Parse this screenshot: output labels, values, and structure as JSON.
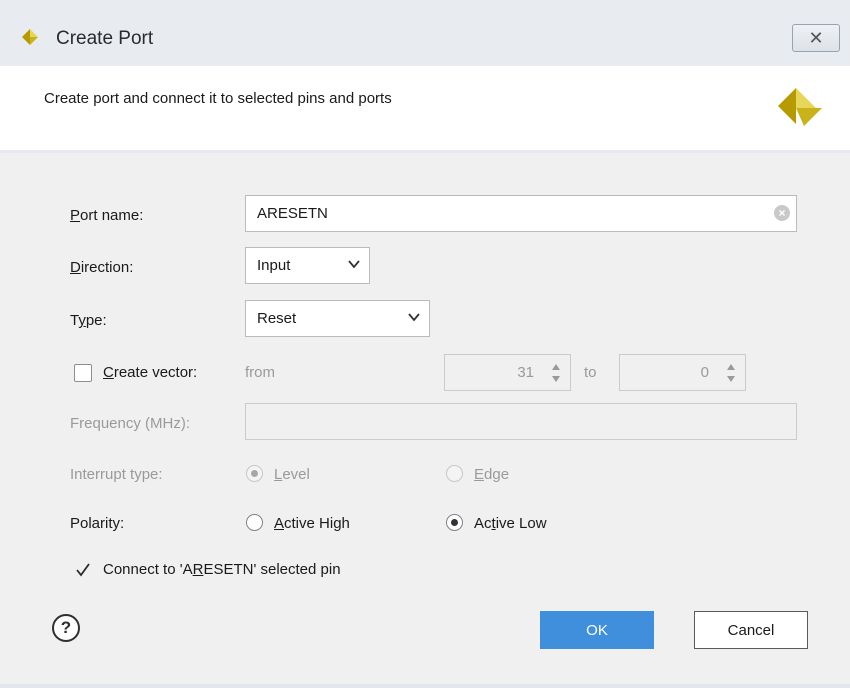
{
  "window": {
    "title": "Create Port",
    "close_glyph": "✕"
  },
  "header": {
    "description": "Create port and connect it to selected pins and ports"
  },
  "form": {
    "port_name": {
      "label_key": "P",
      "label_rest": "ort name:",
      "value": "ARESETN"
    },
    "direction": {
      "label_key": "D",
      "label_rest": "irection:",
      "value": "Input"
    },
    "type": {
      "label_pre": "T",
      "label_key": "y",
      "label_rest": "pe:",
      "value": "Reset"
    },
    "create_vector": {
      "label_key": "C",
      "label_rest": "reate vector:",
      "checked": false,
      "from_label": "from",
      "from_value": "31",
      "to_label": "to",
      "to_value": "0"
    },
    "frequency": {
      "label": "Frequency (MHz):",
      "value": ""
    },
    "interrupt": {
      "label": "Interrupt type:",
      "options": [
        {
          "key": "L",
          "rest": "evel",
          "selected": true
        },
        {
          "key": "E",
          "rest": "dge",
          "selected": false
        }
      ]
    },
    "polarity": {
      "label": "Polarity:",
      "options": [
        {
          "key": "A",
          "rest": "ctive High",
          "selected": false
        },
        {
          "pre": "Ac",
          "key": "t",
          "rest": "ive Low",
          "selected": true
        }
      ]
    },
    "connect": {
      "pre": "Connect to 'A",
      "key": "R",
      "rest": "ESETN' selected  pin",
      "checked": true
    }
  },
  "footer": {
    "help_glyph": "?",
    "ok_label": "OK",
    "cancel_label": "Cancel"
  },
  "colors": {
    "ok_button": "#3f8fdc",
    "logo_gold": "#b79a00",
    "logo_light": "#e6d75a"
  },
  "icons": [
    "xilinx-logo-icon",
    "close-icon",
    "clear-icon",
    "chevron-down-icon",
    "spinner-arrows-icon",
    "help-icon"
  ]
}
